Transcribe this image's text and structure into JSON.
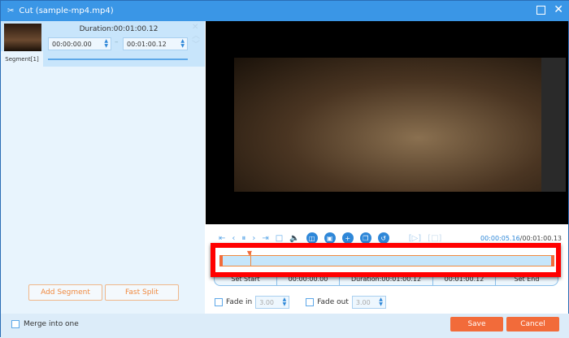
{
  "window": {
    "title": "Cut (sample-mp4.mp4)"
  },
  "segment": {
    "label": "Segment[1]",
    "duration": "Duration:00:01:00.12",
    "start": "00:00:00.00",
    "end": "00:01:00.12"
  },
  "left_buttons": {
    "add_segment": "Add Segment",
    "fast_split": "Fast Split"
  },
  "merge": {
    "label": "Merge into one",
    "checked": false
  },
  "player": {
    "current_time": "00:00:05.16",
    "total_time": "/00:01:00.13",
    "position_fraction": 0.086
  },
  "cut_bar": {
    "set_start": "Set Start",
    "start": "00:00:00.00",
    "duration": "Duration:00:01:00.12",
    "end": "00:01:00.12",
    "set_end": "Set End"
  },
  "fade": {
    "fade_in_label": "Fade in",
    "fade_in_value": "3.00",
    "fade_out_label": "Fade out",
    "fade_out_value": "3.00"
  },
  "actions": {
    "save": "Save",
    "cancel": "Cancel"
  },
  "colors": {
    "title_bar": "#3a96e6",
    "accent": "#f26b3a",
    "highlight": "#ff0000"
  }
}
